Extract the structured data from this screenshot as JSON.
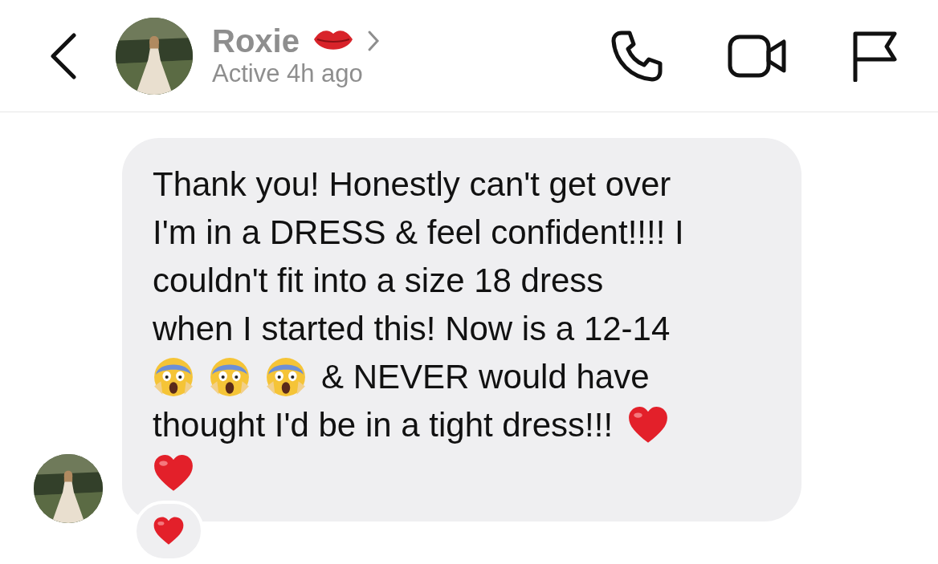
{
  "header": {
    "name": "Roxie",
    "status": "Active 4h ago"
  },
  "message": {
    "lines": [
      [
        {
          "kind": "text",
          "text": "Thank you! Honestly can't get over"
        }
      ],
      [
        {
          "kind": "text",
          "text": "I'm in a DRESS & feel confident!!!! I"
        }
      ],
      [
        {
          "kind": "text",
          "text": "couldn't fit into a size 18 dress"
        }
      ],
      [
        {
          "kind": "text",
          "text": "when I started this! Now is a 12-14"
        }
      ],
      [
        {
          "kind": "scream"
        },
        {
          "kind": "scream"
        },
        {
          "kind": "scream"
        },
        {
          "kind": "text",
          "text": "& NEVER would have"
        }
      ],
      [
        {
          "kind": "text",
          "text": "thought I'd be in a tight dress!!!"
        },
        {
          "kind": "heart"
        }
      ],
      [
        {
          "kind": "heart"
        }
      ]
    ],
    "reactions": [
      {
        "kind": "heart"
      }
    ]
  }
}
